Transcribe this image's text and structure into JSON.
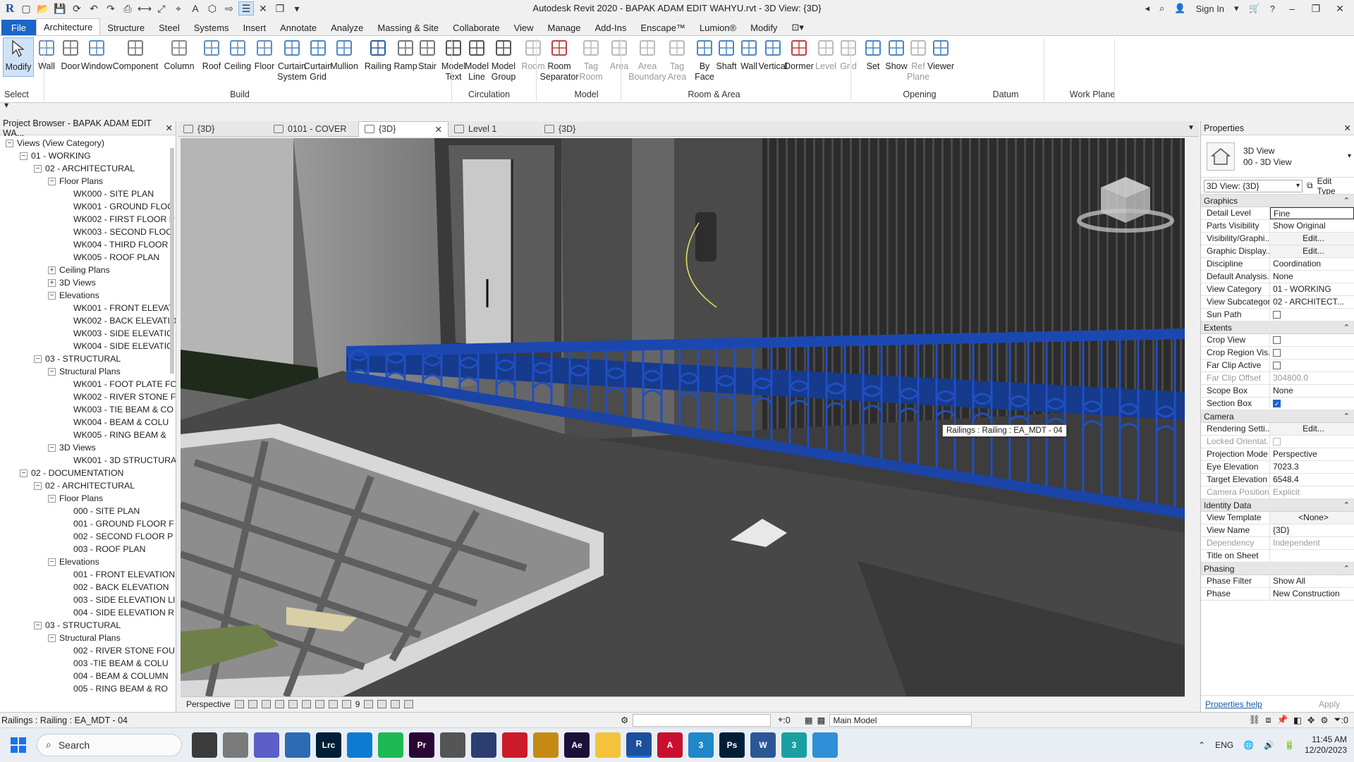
{
  "app": {
    "title": "Autodesk Revit 2020 - BAPAK ADAM EDIT WAHYU.rvt - 3D View: {3D}",
    "sign_in": "Sign In"
  },
  "menu_tabs": [
    "File",
    "Architecture",
    "Structure",
    "Steel",
    "Systems",
    "Insert",
    "Annotate",
    "Analyze",
    "Massing & Site",
    "Collaborate",
    "View",
    "Manage",
    "Add-Ins",
    "Enscape™",
    "Lumion®",
    "Modify"
  ],
  "ribbon": {
    "modify": "Modify",
    "select": "Select",
    "buttons": [
      {
        "label": "Wall",
        "icon": "wall-icon"
      },
      {
        "label": "Door",
        "icon": "door-icon"
      },
      {
        "label": "Window",
        "icon": "window-icon"
      },
      {
        "label": "Component",
        "icon": "component-icon"
      },
      {
        "label": "Column",
        "icon": "column-icon"
      },
      {
        "label": "Roof",
        "icon": "roof-icon"
      },
      {
        "label": "Ceiling",
        "icon": "ceiling-icon"
      },
      {
        "label": "Floor",
        "icon": "floor-icon"
      },
      {
        "label": "Curtain\nSystem",
        "icon": "curtain-system-icon"
      },
      {
        "label": "Curtain\nGrid",
        "icon": "curtain-grid-icon"
      },
      {
        "label": "Mullion",
        "icon": "mullion-icon"
      },
      {
        "label": "Railing",
        "icon": "railing-icon"
      },
      {
        "label": "Ramp",
        "icon": "ramp-icon"
      },
      {
        "label": "Stair",
        "icon": "stair-icon"
      },
      {
        "label": "Model\nText",
        "icon": "model-text-icon"
      },
      {
        "label": "Model\nLine",
        "icon": "model-line-icon"
      },
      {
        "label": "Model\nGroup",
        "icon": "model-group-icon"
      },
      {
        "label": "Room",
        "icon": "room-icon"
      },
      {
        "label": "Room\nSeparator",
        "icon": "room-separator-icon"
      },
      {
        "label": "Tag\nRoom",
        "icon": "tag-room-icon"
      },
      {
        "label": "Area",
        "icon": "area-icon"
      },
      {
        "label": "Area\nBoundary",
        "icon": "area-boundary-icon"
      },
      {
        "label": "Tag\nArea",
        "icon": "tag-area-icon"
      },
      {
        "label": "By\nFace",
        "icon": "by-face-icon"
      },
      {
        "label": "Shaft",
        "icon": "shaft-icon"
      },
      {
        "label": "Wall",
        "icon": "opening-wall-icon"
      },
      {
        "label": "Vertical",
        "icon": "vertical-icon"
      },
      {
        "label": "Dormer",
        "icon": "dormer-icon"
      },
      {
        "label": "Level",
        "icon": "level-icon"
      },
      {
        "label": "Grid",
        "icon": "grid-icon"
      },
      {
        "label": "Set",
        "icon": "set-icon"
      },
      {
        "label": "Show",
        "icon": "show-icon"
      },
      {
        "label": "Ref\nPlane",
        "icon": "ref-plane-icon"
      },
      {
        "label": "Viewer",
        "icon": "viewer-icon"
      }
    ],
    "groups": [
      "Build",
      "Circulation",
      "Model",
      "Room & Area",
      "Opening",
      "Datum",
      "Work Plane"
    ]
  },
  "project_browser": {
    "title": "Project Browser - BAPAK ADAM EDIT WA...",
    "items": [
      {
        "label": "Views (View Category)",
        "level": 0,
        "toggle": "−"
      },
      {
        "label": "01 - WORKING",
        "level": 1,
        "toggle": "−"
      },
      {
        "label": "02 - ARCHITECTURAL",
        "level": 2,
        "toggle": "−"
      },
      {
        "label": "Floor Plans",
        "level": 3,
        "toggle": "−"
      },
      {
        "label": "WK000 - SITE PLAN",
        "level": 4,
        "toggle": ""
      },
      {
        "label": "WK001 - GROUND FLOO",
        "level": 4,
        "toggle": ""
      },
      {
        "label": "WK002 - FIRST FLOOR P",
        "level": 4,
        "toggle": ""
      },
      {
        "label": "WK003 - SECOND FLOO",
        "level": 4,
        "toggle": ""
      },
      {
        "label": "WK004 - THIRD FLOOR",
        "level": 4,
        "toggle": ""
      },
      {
        "label": "WK005 - ROOF PLAN",
        "level": 4,
        "toggle": ""
      },
      {
        "label": "Ceiling Plans",
        "level": 3,
        "toggle": "+"
      },
      {
        "label": "3D Views",
        "level": 3,
        "toggle": "+"
      },
      {
        "label": "Elevations",
        "level": 3,
        "toggle": "−"
      },
      {
        "label": "WK001 - FRONT ELEVAT",
        "level": 4,
        "toggle": ""
      },
      {
        "label": "WK002 - BACK ELEVATIO",
        "level": 4,
        "toggle": ""
      },
      {
        "label": "WK003 - SIDE ELEVATIO",
        "level": 4,
        "toggle": ""
      },
      {
        "label": "WK004 - SIDE ELEVATIO",
        "level": 4,
        "toggle": ""
      },
      {
        "label": "03 - STRUCTURAL",
        "level": 2,
        "toggle": "−"
      },
      {
        "label": "Structural Plans",
        "level": 3,
        "toggle": "−"
      },
      {
        "label": "WK001 - FOOT PLATE FO",
        "level": 4,
        "toggle": ""
      },
      {
        "label": "WK002 - RIVER STONE F",
        "level": 4,
        "toggle": ""
      },
      {
        "label": "WK003 - TIE BEAM & CO",
        "level": 4,
        "toggle": ""
      },
      {
        "label": "WK004 - BEAM & COLU",
        "level": 4,
        "toggle": ""
      },
      {
        "label": "WK005 - RING BEAM &",
        "level": 4,
        "toggle": ""
      },
      {
        "label": "3D Views",
        "level": 3,
        "toggle": "−"
      },
      {
        "label": "WK001 - 3D STRUCTURA",
        "level": 4,
        "toggle": ""
      },
      {
        "label": "02 - DOCUMENTATION",
        "level": 1,
        "toggle": "−"
      },
      {
        "label": "02 - ARCHITECTURAL",
        "level": 2,
        "toggle": "−"
      },
      {
        "label": "Floor Plans",
        "level": 3,
        "toggle": "−"
      },
      {
        "label": "000 - SITE PLAN",
        "level": 4,
        "toggle": ""
      },
      {
        "label": "001 - GROUND FLOOR F",
        "level": 4,
        "toggle": ""
      },
      {
        "label": "002 - SECOND FLOOR P",
        "level": 4,
        "toggle": ""
      },
      {
        "label": "003 - ROOF PLAN",
        "level": 4,
        "toggle": ""
      },
      {
        "label": "Elevations",
        "level": 3,
        "toggle": "−"
      },
      {
        "label": "001 - FRONT ELEVATION",
        "level": 4,
        "toggle": ""
      },
      {
        "label": "002 - BACK ELEVATION",
        "level": 4,
        "toggle": ""
      },
      {
        "label": "003 - SIDE ELEVATION LI",
        "level": 4,
        "toggle": ""
      },
      {
        "label": "004 - SIDE ELEVATION R",
        "level": 4,
        "toggle": ""
      },
      {
        "label": "03 - STRUCTURAL",
        "level": 2,
        "toggle": "−"
      },
      {
        "label": "Structural Plans",
        "level": 3,
        "toggle": "−"
      },
      {
        "label": "002 - RIVER STONE FOU",
        "level": 4,
        "toggle": ""
      },
      {
        "label": "003 -TIE BEAM & COLU",
        "level": 4,
        "toggle": ""
      },
      {
        "label": "004 - BEAM & COLUMN",
        "level": 4,
        "toggle": ""
      },
      {
        "label": "005 - RING BEAM & RO",
        "level": 4,
        "toggle": ""
      }
    ]
  },
  "view_tabs": [
    {
      "label": "{3D}",
      "active": false
    },
    {
      "label": "0101 - COVER",
      "active": false
    },
    {
      "label": "{3D}",
      "active": true
    },
    {
      "label": "Level 1",
      "active": false
    },
    {
      "label": "{3D}",
      "active": false
    }
  ],
  "viewport": {
    "tooltip": "Railings : Railing : EA_MDT - 04",
    "view_control_label": "Perspective",
    "scale_readout": "9"
  },
  "properties": {
    "title": "Properties",
    "type_name_line1": "3D View",
    "type_name_line2": "00 - 3D View",
    "instance_select": "3D View: {3D}",
    "edit_type": "Edit Type",
    "groups": [
      {
        "name": "Graphics",
        "rows": [
          {
            "key": "Detail Level",
            "value": "Fine",
            "kind": "boxed"
          },
          {
            "key": "Parts Visibility",
            "value": "Show Original",
            "kind": "text"
          },
          {
            "key": "Visibility/Graphi...",
            "value": "Edit...",
            "kind": "btn"
          },
          {
            "key": "Graphic Display...",
            "value": "Edit...",
            "kind": "btn"
          },
          {
            "key": "Discipline",
            "value": "Coordination",
            "kind": "text"
          },
          {
            "key": "Default Analysis...",
            "value": "None",
            "kind": "text"
          },
          {
            "key": "View Category",
            "value": "01 - WORKING",
            "kind": "text"
          },
          {
            "key": "View Subcategory",
            "value": "02 - ARCHITECT...",
            "kind": "text"
          },
          {
            "key": "Sun Path",
            "value": "",
            "kind": "cb"
          }
        ]
      },
      {
        "name": "Extents",
        "rows": [
          {
            "key": "Crop View",
            "value": "",
            "kind": "cb"
          },
          {
            "key": "Crop Region Vis...",
            "value": "",
            "kind": "cb"
          },
          {
            "key": "Far Clip Active",
            "value": "",
            "kind": "cb"
          },
          {
            "key": "Far Clip Offset",
            "value": "304800.0",
            "kind": "dim"
          },
          {
            "key": "Scope Box",
            "value": "None",
            "kind": "text"
          },
          {
            "key": "Section Box",
            "value": "",
            "kind": "cbon"
          }
        ]
      },
      {
        "name": "Camera",
        "rows": [
          {
            "key": "Rendering Setti...",
            "value": "Edit...",
            "kind": "btn"
          },
          {
            "key": "Locked Orientat...",
            "value": "",
            "kind": "cbdim"
          },
          {
            "key": "Projection Mode",
            "value": "Perspective",
            "kind": "text"
          },
          {
            "key": "Eye Elevation",
            "value": "7023.3",
            "kind": "text"
          },
          {
            "key": "Target Elevation",
            "value": "6548.4",
            "kind": "text"
          },
          {
            "key": "Camera Position",
            "value": "Explicit",
            "kind": "dim"
          }
        ]
      },
      {
        "name": "Identity Data",
        "rows": [
          {
            "key": "View Template",
            "value": "<None>",
            "kind": "btn"
          },
          {
            "key": "View Name",
            "value": "{3D}",
            "kind": "text"
          },
          {
            "key": "Dependency",
            "value": "Independent",
            "kind": "dim"
          },
          {
            "key": "Title on Sheet",
            "value": "",
            "kind": "text"
          }
        ]
      },
      {
        "name": "Phasing",
        "rows": [
          {
            "key": "Phase Filter",
            "value": "Show All",
            "kind": "text"
          },
          {
            "key": "Phase",
            "value": "New Construction",
            "kind": "text"
          }
        ]
      }
    ],
    "help_link": "Properties help",
    "apply": "Apply"
  },
  "status_bar": {
    "left_text": "Railings : Railing : EA_MDT - 04",
    "selection_count": ":0",
    "model": "Main Model",
    "filter_count": ":0"
  },
  "taskbar": {
    "search": "Search",
    "lang": "ENG",
    "time": "11:45 AM",
    "date": "12/20/2023",
    "apps": [
      {
        "name": "file-explorer-app-icon",
        "color": "#3b3b3b",
        "text": ""
      },
      {
        "name": "cloud-app-icon",
        "color": "#7a7a7a",
        "text": ""
      },
      {
        "name": "teams-app-icon",
        "color": "#5b5fc7",
        "text": ""
      },
      {
        "name": "photos-app-icon",
        "color": "#2b6cb3",
        "text": ""
      },
      {
        "name": "lightroom-app-icon",
        "color": "#001e36",
        "text": "Lrc"
      },
      {
        "name": "edge-app-icon",
        "color": "#0c7bd1",
        "text": ""
      },
      {
        "name": "spotify-app-icon",
        "color": "#1db954",
        "text": ""
      },
      {
        "name": "premiere-app-icon",
        "color": "#2a0634",
        "text": "Pr"
      },
      {
        "name": "browser-app-icon",
        "color": "#555",
        "text": ""
      },
      {
        "name": "calculator-app-icon",
        "color": "#2c3e70",
        "text": ""
      },
      {
        "name": "opera-app-icon",
        "color": "#cc1b28",
        "text": ""
      },
      {
        "name": "media-app-icon",
        "color": "#c48a14",
        "text": ""
      },
      {
        "name": "after-effects-app-icon",
        "color": "#1c0f3a",
        "text": "Ae"
      },
      {
        "name": "folder-app-icon",
        "color": "#f3c33c",
        "text": ""
      },
      {
        "name": "revit-app-icon",
        "color": "#1c4f9c",
        "text": "R"
      },
      {
        "name": "autocad-app-icon",
        "color": "#c8102e",
        "text": "A"
      },
      {
        "name": "app-3-icon",
        "color": "#1e88c8",
        "text": "3"
      },
      {
        "name": "photoshop-app-icon",
        "color": "#001e36",
        "text": "Ps"
      },
      {
        "name": "word-app-icon",
        "color": "#2b5797",
        "text": "W"
      },
      {
        "name": "app-3b-icon",
        "color": "#19a0a0",
        "text": "3"
      },
      {
        "name": "globe-app-icon",
        "color": "#2f8fd6",
        "text": ""
      }
    ]
  }
}
